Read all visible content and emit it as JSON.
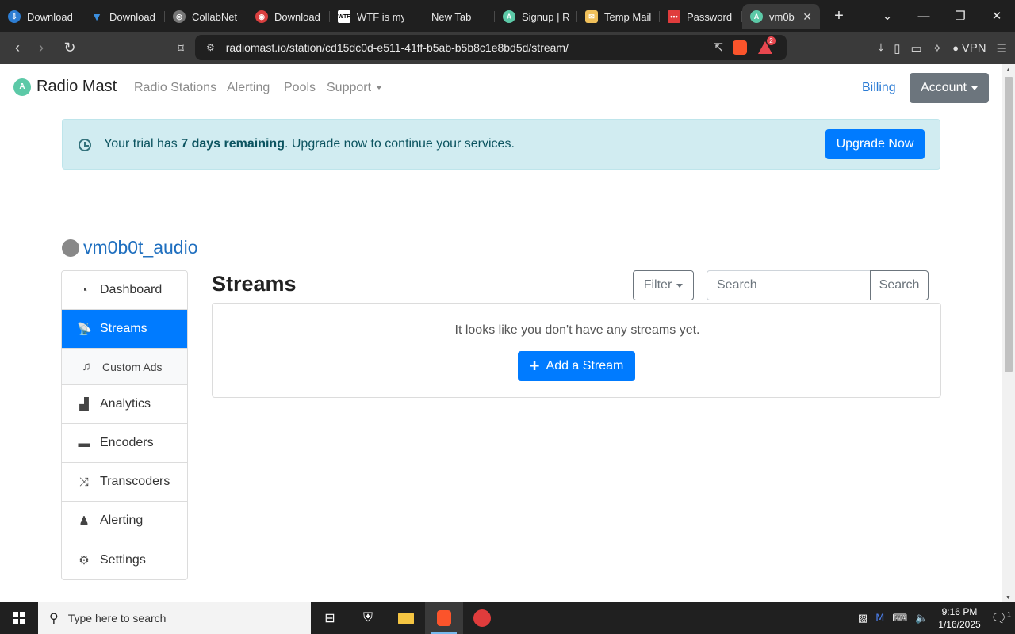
{
  "browser": {
    "tabs": [
      {
        "label": "Download",
        "color": "#2d7dd2"
      },
      {
        "label": "Download",
        "color": "#3b8ede"
      },
      {
        "label": "CollabNet",
        "color": "#777777"
      },
      {
        "label": "Download",
        "color": "#d93f3f"
      },
      {
        "label": "WTF is my",
        "color": "#ffffff"
      },
      {
        "label": "New Tab",
        "color": ""
      },
      {
        "label": "Signup | R",
        "color": "#5cc9a7"
      },
      {
        "label": "Temp Mail",
        "color": "#f0c05a"
      },
      {
        "label": "Password",
        "color": "#e03c3c"
      },
      {
        "label": "vm0b",
        "color": "#5cc9a7"
      }
    ],
    "url": "radiomast.io/station/cd15dc0d-e511-41ff-b5ab-b5b8c1e8bd5d/stream/",
    "vpn_label": "VPN",
    "rewards_badge": "2"
  },
  "nav": {
    "brand": "Radio Mast",
    "links": [
      "Radio Stations",
      "Alerting",
      "Pools",
      "Support"
    ],
    "billing": "Billing",
    "account": "Account"
  },
  "alert": {
    "prefix": "Your trial has ",
    "bold": "7 days remaining",
    "suffix": ". Upgrade now to continue your services.",
    "button": "Upgrade Now"
  },
  "station": {
    "name": "vm0b0t_audio"
  },
  "sidebar": {
    "items": [
      {
        "label": "Dashboard",
        "icon": "dashboard-icon"
      },
      {
        "label": "Streams",
        "icon": "satellite-dish-icon"
      },
      {
        "label": "Custom Ads",
        "icon": "music-icon"
      },
      {
        "label": "Analytics",
        "icon": "bar-chart-icon"
      },
      {
        "label": "Encoders",
        "icon": "laptop-icon"
      },
      {
        "label": "Transcoders",
        "icon": "shuffle-icon"
      },
      {
        "label": "Alerting",
        "icon": "user-alert-icon"
      },
      {
        "label": "Settings",
        "icon": "gear-icon"
      }
    ]
  },
  "main": {
    "title": "Streams",
    "filter": "Filter",
    "search_placeholder": "Search",
    "search_button": "Search",
    "empty_text": "It looks like you don't have any streams yet.",
    "add_button": "Add a Stream"
  },
  "taskbar": {
    "search_placeholder": "Type here to search",
    "time": "9:16 PM",
    "date": "1/16/2025",
    "notifications": "1"
  }
}
